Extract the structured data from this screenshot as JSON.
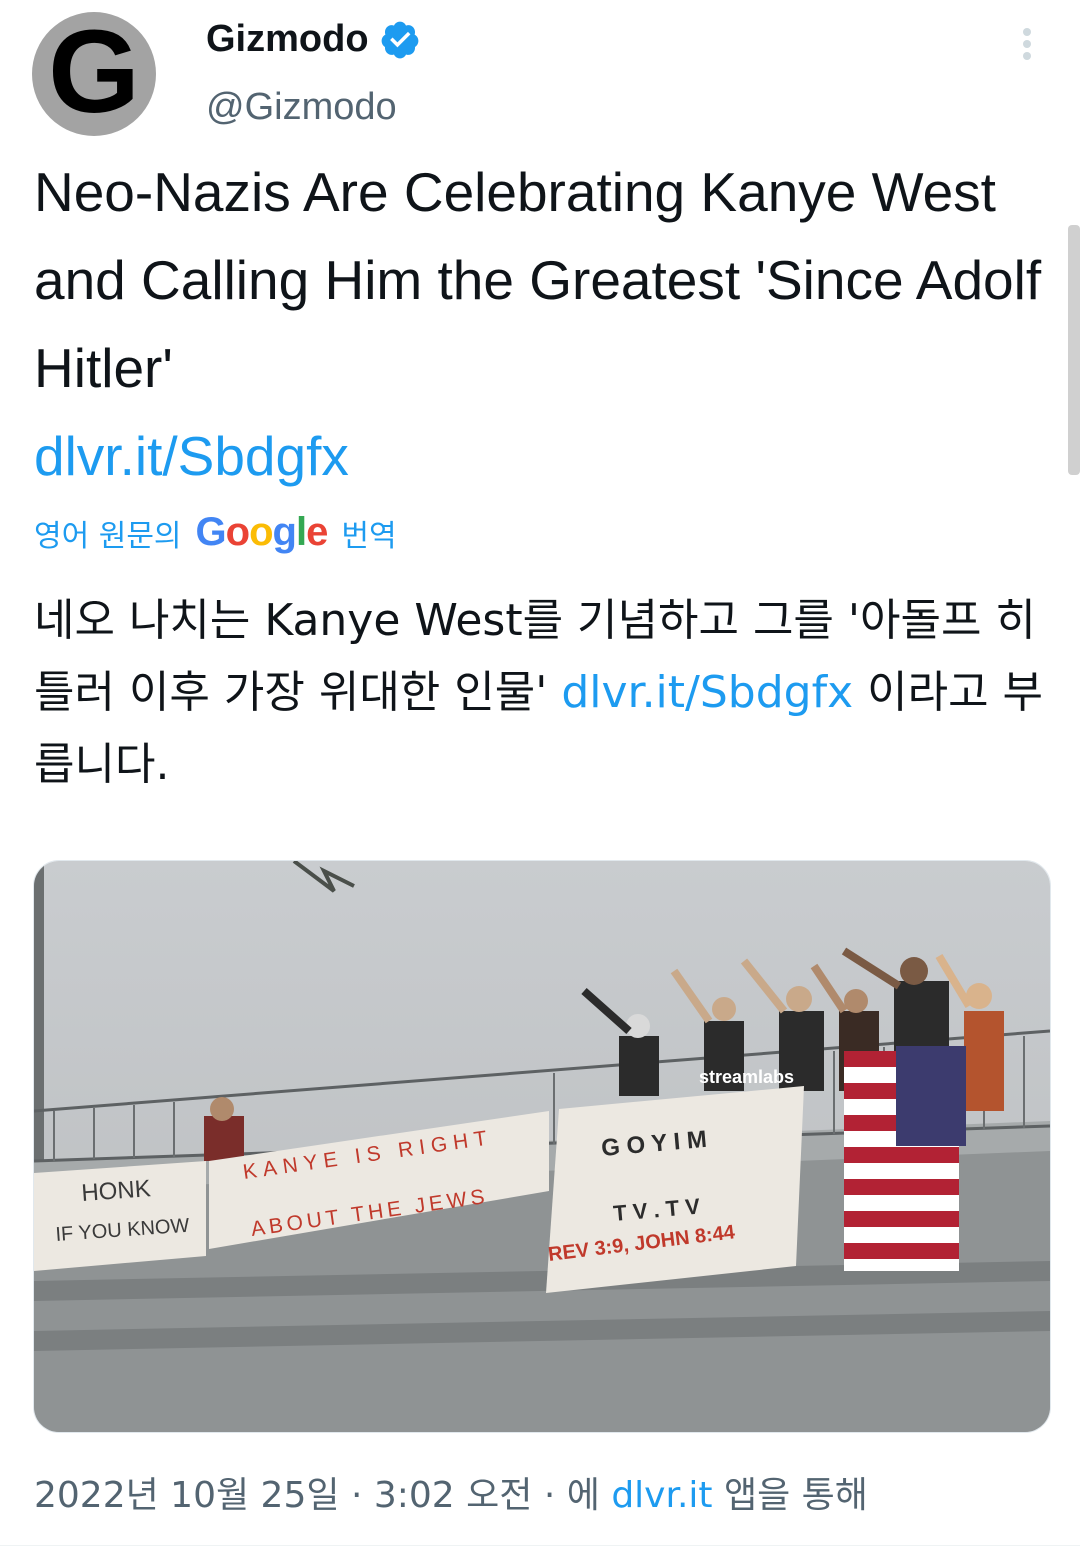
{
  "author": {
    "avatar_letter": "G",
    "display_name": "Gizmodo",
    "handle": "@Gizmodo",
    "verified": true
  },
  "tweet": {
    "text_before_link": "Neo-Nazis Are Celebrating Kanye West and Calling Him the Greatest 'Since Adolf Hitler'",
    "link": "dlvr.it/Sbdgfx"
  },
  "translation": {
    "label_prefix": "영어 원문의",
    "provider": "Google",
    "label_suffix": "번역",
    "text_before_link": "네오 나치는 Kanye West를 기념하고 그를 '아돌프 히틀러 이후 가장 위대한 인물'",
    "link": "dlvr.it/Sbdgfx",
    "text_after_link": "이라고 부릅니다."
  },
  "media": {
    "banners": [
      "HONK",
      "IF YOU KNOW",
      "KANYE IS RIGHT",
      "ABOUT THE JEWS",
      "G O Y I M",
      "T V . T V",
      "REV 3:9, JOHN 8:44"
    ],
    "watermark": "streamlabs"
  },
  "meta": {
    "date": "2022년 10월 25일",
    "sep1": "·",
    "time": "3:02 오전",
    "sep2": "·",
    "via_prefix": "에",
    "source": "dlvr.it",
    "via_suffix": "앱을 통해"
  },
  "colors": {
    "link": "#1d9bf0",
    "verified": "#1d9bf0",
    "secondary_text": "#536471"
  }
}
